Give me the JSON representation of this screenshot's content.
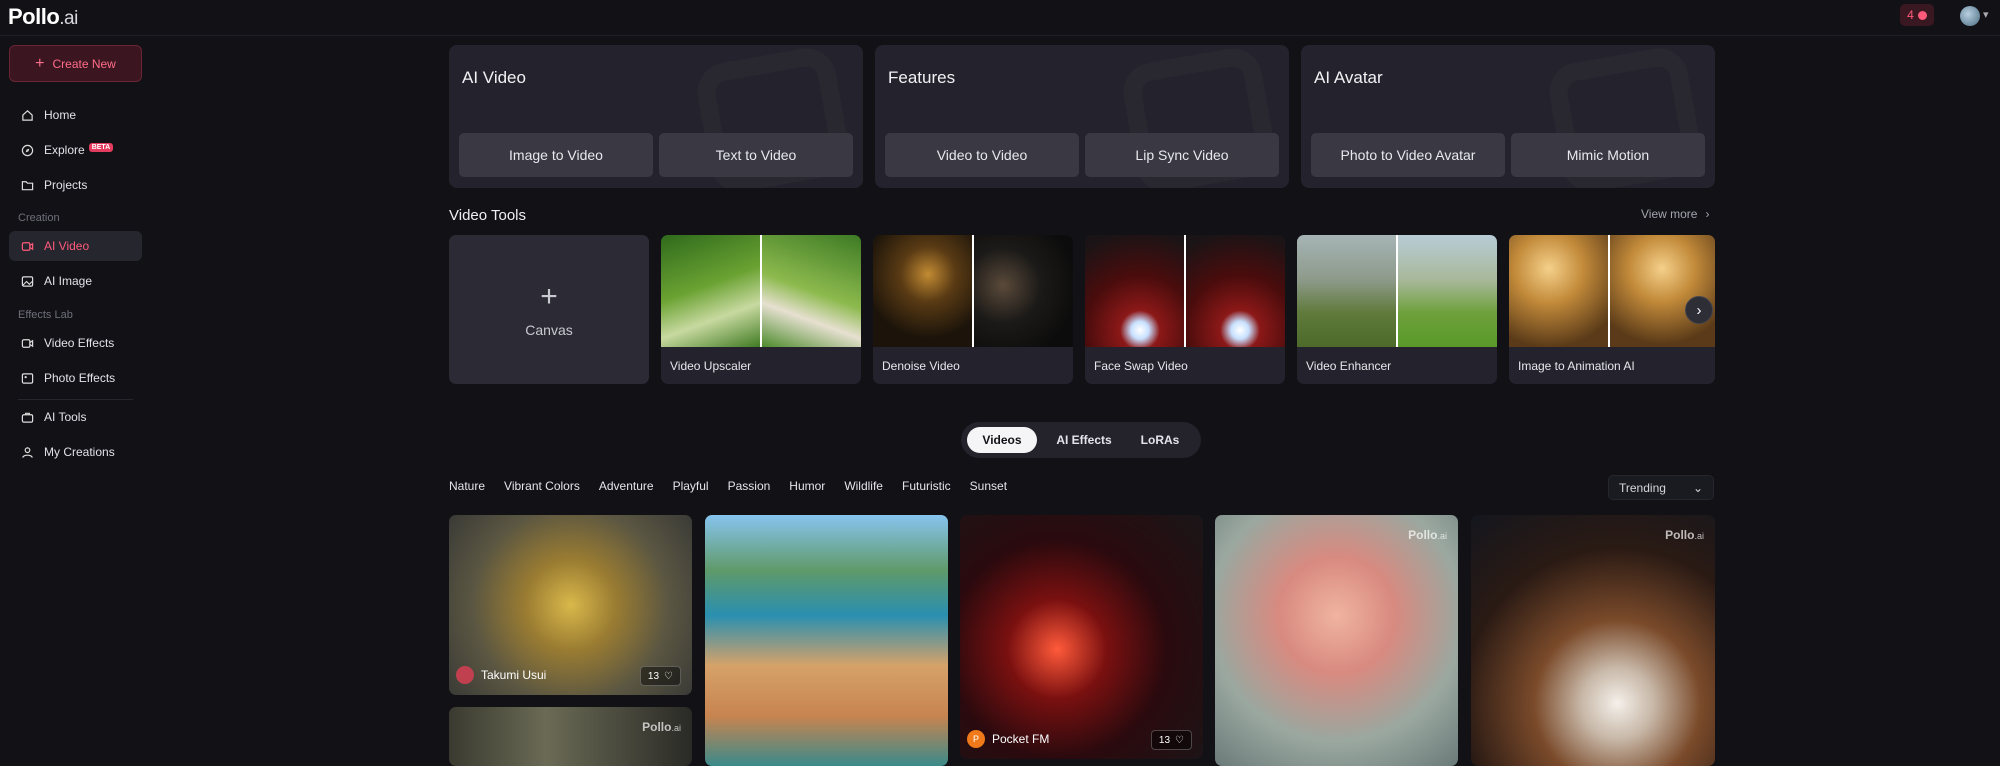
{
  "app": {
    "logo_main": "Pollo",
    "logo_suffix": ".ai",
    "credits": "4"
  },
  "sidebar": {
    "create_label": "Create New",
    "items": [
      {
        "label": "Home",
        "icon": "home-icon"
      },
      {
        "label": "Explore",
        "icon": "compass-icon",
        "badge": "BETA"
      },
      {
        "label": "Projects",
        "icon": "folder-icon"
      },
      {
        "label": "AI Video",
        "icon": "video-icon",
        "active": true
      },
      {
        "label": "AI Image",
        "icon": "image-icon"
      },
      {
        "label": "Video Effects",
        "icon": "video-effects-icon"
      },
      {
        "label": "Photo Effects",
        "icon": "photo-effects-icon"
      },
      {
        "label": "AI Tools",
        "icon": "toolbox-icon"
      },
      {
        "label": "My Creations",
        "icon": "creations-icon"
      }
    ],
    "sections": {
      "creation": "Creation",
      "effects_lab": "Effects Lab"
    }
  },
  "top_cards": [
    {
      "title": "AI Video",
      "buttons": [
        "Image to Video",
        "Text to Video"
      ]
    },
    {
      "title": "Features",
      "buttons": [
        "Video to Video",
        "Lip Sync Video"
      ]
    },
    {
      "title": "AI Avatar",
      "buttons": [
        "Photo to Video Avatar",
        "Mimic Motion"
      ]
    }
  ],
  "video_tools": {
    "title": "Video Tools",
    "view_more": "View more",
    "canvas_label": "Canvas",
    "tools": [
      "Video Upscaler",
      "Denoise Video",
      "Face Swap Video",
      "Video Enhancer",
      "Image to Animation AI"
    ]
  },
  "content_tabs": [
    "Videos",
    "AI Effects",
    "LoRAs"
  ],
  "filters": [
    "Nature",
    "Vibrant Colors",
    "Adventure",
    "Playful",
    "Passion",
    "Humor",
    "Wildlife",
    "Futuristic",
    "Sunset"
  ],
  "sort": {
    "selected": "Trending"
  },
  "gallery": {
    "watermark_main": "Pollo",
    "watermark_suffix": ".ai",
    "items": [
      {
        "author": "Takumi Usui",
        "likes": "13"
      },
      {
        "author": "Pocket FM",
        "author_initial": "P",
        "likes": "13"
      }
    ]
  },
  "colors": {
    "accent": "#ff5a7a",
    "background": "#111116",
    "card": "#24232d"
  }
}
